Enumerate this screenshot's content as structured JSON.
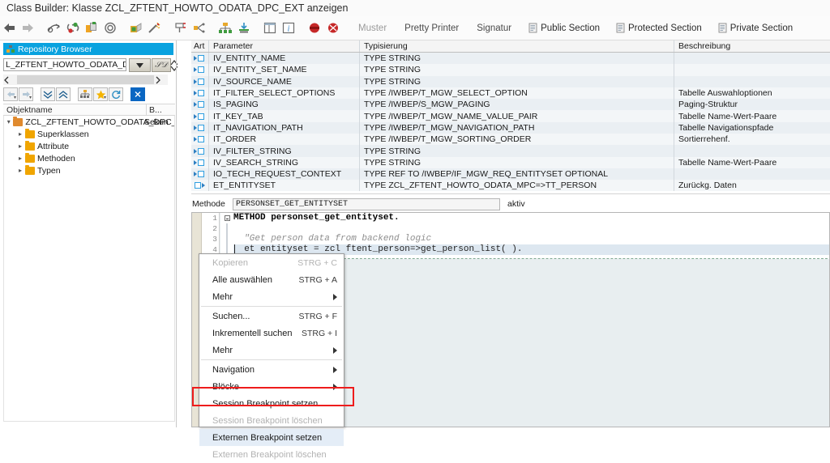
{
  "window": {
    "title": "Class Builder: Klasse ZCL_ZFTENT_HOWTO_ODATA_DPC_EXT anzeigen"
  },
  "toolbar": {
    "icons": [
      {
        "name": "back-icon",
        "glyph": "←"
      },
      {
        "name": "forward-icon",
        "glyph": "→"
      },
      {
        "name": "display-change-icon",
        "glyph": "✎"
      },
      {
        "name": "check-icon",
        "glyph": "●"
      },
      {
        "name": "activate-icon",
        "glyph": "■"
      },
      {
        "name": "pattern-ring-icon",
        "glyph": "◎"
      },
      {
        "name": "lock-icon",
        "glyph": "▣"
      },
      {
        "name": "wand-icon",
        "glyph": "✦"
      },
      {
        "name": "tools-icon",
        "glyph": "⊤"
      },
      {
        "name": "where-used-icon",
        "glyph": "≺"
      },
      {
        "name": "hierarchy-icon",
        "glyph": "☳"
      },
      {
        "name": "import-icon",
        "glyph": "⤓"
      },
      {
        "name": "split-view-icon",
        "glyph": "▥"
      },
      {
        "name": "info-icon",
        "glyph": "i"
      },
      {
        "name": "breakpoint-icon",
        "glyph": "●"
      },
      {
        "name": "breakpoint-alt-icon",
        "glyph": "●"
      }
    ],
    "muster_label": "Muster",
    "pretty_printer_label": "Pretty Printer",
    "signatur_label": "Signatur",
    "public_section_label": "Public Section",
    "protected_section_label": "Protected Section",
    "private_section_label": "Private Section"
  },
  "sidebar": {
    "panel_title": "Repository Browser",
    "search_value": "L_ZFTENT_HOWTO_ODATA_DPC_E",
    "search_clear": "×",
    "tree_columns": [
      "Objektname",
      "B..."
    ],
    "tree": [
      {
        "label": "ZCL_ZFTENT_HOWTO_ODATA_DPC_E",
        "col2": "Sekun",
        "level": 0,
        "type": "class"
      },
      {
        "label": "Superklassen",
        "col2": "",
        "level": 1,
        "type": "folder"
      },
      {
        "label": "Attribute",
        "col2": "",
        "level": 1,
        "type": "folder"
      },
      {
        "label": "Methoden",
        "col2": "",
        "level": 1,
        "type": "folder"
      },
      {
        "label": "Typen",
        "col2": "",
        "level": 1,
        "type": "folder"
      }
    ]
  },
  "parameters": {
    "columns": [
      "Art",
      "Parameter",
      "Typisierung",
      "Beschreibung"
    ],
    "rows": [
      {
        "art": "importing",
        "parameter": "IV_ENTITY_NAME",
        "typisierung": "TYPE STRING",
        "beschreibung": ""
      },
      {
        "art": "importing",
        "parameter": "IV_ENTITY_SET_NAME",
        "typisierung": "TYPE STRING",
        "beschreibung": ""
      },
      {
        "art": "importing",
        "parameter": "IV_SOURCE_NAME",
        "typisierung": "TYPE STRING",
        "beschreibung": ""
      },
      {
        "art": "importing",
        "parameter": "IT_FILTER_SELECT_OPTIONS",
        "typisierung": "TYPE /IWBEP/T_MGW_SELECT_OPTION",
        "beschreibung": "Tabelle Auswahloptionen"
      },
      {
        "art": "importing",
        "parameter": "IS_PAGING",
        "typisierung": "TYPE /IWBEP/S_MGW_PAGING",
        "beschreibung": "Paging-Struktur"
      },
      {
        "art": "importing",
        "parameter": "IT_KEY_TAB",
        "typisierung": "TYPE /IWBEP/T_MGW_NAME_VALUE_PAIR",
        "beschreibung": "Tabelle Name-Wert-Paare"
      },
      {
        "art": "importing",
        "parameter": "IT_NAVIGATION_PATH",
        "typisierung": "TYPE /IWBEP/T_MGW_NAVIGATION_PATH",
        "beschreibung": "Tabelle Navigationspfade"
      },
      {
        "art": "importing",
        "parameter": "IT_ORDER",
        "typisierung": "TYPE /IWBEP/T_MGW_SORTING_ORDER",
        "beschreibung": "Sortierrehenf."
      },
      {
        "art": "importing",
        "parameter": "IV_FILTER_STRING",
        "typisierung": "TYPE STRING",
        "beschreibung": ""
      },
      {
        "art": "importing",
        "parameter": "IV_SEARCH_STRING",
        "typisierung": "TYPE STRING",
        "beschreibung": "Tabelle Name-Wert-Paare"
      },
      {
        "art": "importing",
        "parameter": "IO_TECH_REQUEST_CONTEXT",
        "typisierung": "TYPE REF TO /IWBEP/IF_MGW_REQ_ENTITYSET OPTIONAL",
        "beschreibung": ""
      },
      {
        "art": "exporting",
        "parameter": "ET_ENTITYSET",
        "typisierung": "TYPE ZCL_ZFTENT_HOWTO_ODATA_MPC=>TT_PERSON",
        "beschreibung": "Zurückg. Daten"
      }
    ]
  },
  "method_bar": {
    "label": "Methode",
    "value": "PERSONSET_GET_ENTITYSET",
    "status": "aktiv"
  },
  "editor": {
    "lines": [
      {
        "num": "1",
        "text": "METHOD personset_get_entityset.",
        "kind": "keyword-stmt",
        "highlight": false
      },
      {
        "num": "2",
        "text": "",
        "kind": "blank",
        "highlight": false
      },
      {
        "num": "3",
        "text": "\"Get person data from backend logic",
        "kind": "comment",
        "highlight": false
      },
      {
        "num": "4",
        "text": "et entityset = zcl ftent_person=>get_person_list( ).",
        "kind": "code",
        "highlight": true
      }
    ]
  },
  "context_menu": {
    "items": [
      {
        "label": "Kopieren",
        "accel": "STRG + C",
        "disabled": true,
        "submenu": false,
        "mnemonic": "K",
        "separator_after": false
      },
      {
        "label": "Alle auswählen",
        "accel": "STRG + A",
        "disabled": false,
        "submenu": false,
        "mnemonic": "l",
        "separator_after": false
      },
      {
        "label": "Mehr",
        "accel": "",
        "disabled": false,
        "submenu": true,
        "mnemonic": "M",
        "separator_after": true
      },
      {
        "label": "Suchen...",
        "accel": "STRG + F",
        "disabled": false,
        "submenu": false,
        "mnemonic": "S",
        "separator_after": false
      },
      {
        "label": "Inkrementell suchen",
        "accel": "STRG + I",
        "disabled": false,
        "submenu": false,
        "mnemonic": "I",
        "separator_after": false
      },
      {
        "label": "Mehr",
        "accel": "",
        "disabled": false,
        "submenu": true,
        "mnemonic": "h",
        "separator_after": true
      },
      {
        "label": "Navigation",
        "accel": "",
        "disabled": false,
        "submenu": true,
        "mnemonic": "N",
        "separator_after": false
      },
      {
        "label": "Blöcke",
        "accel": "",
        "disabled": false,
        "submenu": true,
        "mnemonic": "l",
        "separator_after": false
      },
      {
        "label": "Session Breakpoint setzen",
        "accel": "",
        "disabled": false,
        "submenu": false,
        "mnemonic": "S",
        "separator_after": false
      },
      {
        "label": "Session Breakpoint löschen",
        "accel": "",
        "disabled": true,
        "submenu": false,
        "mnemonic": "",
        "separator_after": false
      },
      {
        "label": "Externen Breakpoint setzen",
        "accel": "",
        "disabled": false,
        "submenu": false,
        "mnemonic": "E",
        "separator_after": false,
        "highlighted": true
      },
      {
        "label": "Externen Breakpoint löschen",
        "accel": "",
        "disabled": true,
        "submenu": false,
        "mnemonic": "",
        "separator_after": false
      }
    ]
  },
  "colors": {
    "panel_header": "#09a2df",
    "highlight_red": "#ee1c1c",
    "code_highlight": "#dde7f0",
    "editor_bg": "#e8eef0",
    "folder": "#f0a500"
  }
}
